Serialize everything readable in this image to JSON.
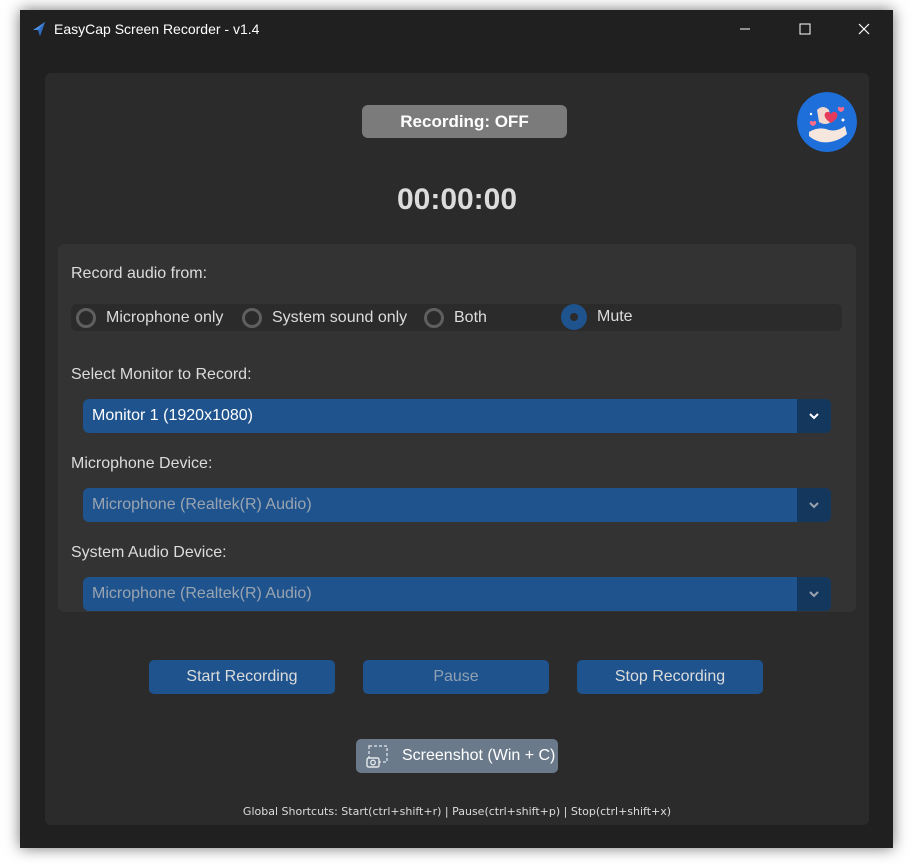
{
  "window": {
    "title": "EasyCap Screen Recorder - v1.4",
    "controls": {
      "minimize_icon": "minimize-icon",
      "maximize_icon": "maximize-icon",
      "close_icon": "close-icon"
    }
  },
  "header": {
    "recording_status": "Recording: OFF",
    "timer": "00:00:00",
    "avatar_icon": "hands-hearts-avatar"
  },
  "audio": {
    "label": "Record audio from:",
    "options": [
      {
        "label": "Microphone only",
        "selected": false
      },
      {
        "label": "System sound only",
        "selected": false
      },
      {
        "label": "Both",
        "selected": false
      },
      {
        "label": "Mute",
        "selected": true
      }
    ]
  },
  "monitor": {
    "label": "Select Monitor to Record:",
    "value": "Monitor 1 (1920x1080)"
  },
  "microphone": {
    "label": "Microphone Device:",
    "value": "Microphone (Realtek(R) Audio)"
  },
  "system_audio": {
    "label": "System Audio Device:",
    "value": "Microphone (Realtek(R) Audio)"
  },
  "buttons": {
    "start": "Start Recording",
    "pause": "Pause",
    "stop": "Stop Recording",
    "screenshot": "Screenshot (Win + C)"
  },
  "footer": {
    "shortcuts": "Global Shortcuts: Start(ctrl+shift+r) | Pause(ctrl+shift+p) | Stop(ctrl+shift+x)"
  },
  "colors": {
    "accent": "#1f538d",
    "accent_dark": "#14375e",
    "status_off": "#7b7b7b",
    "background": "#202020",
    "panel": "#2b2b2b"
  }
}
